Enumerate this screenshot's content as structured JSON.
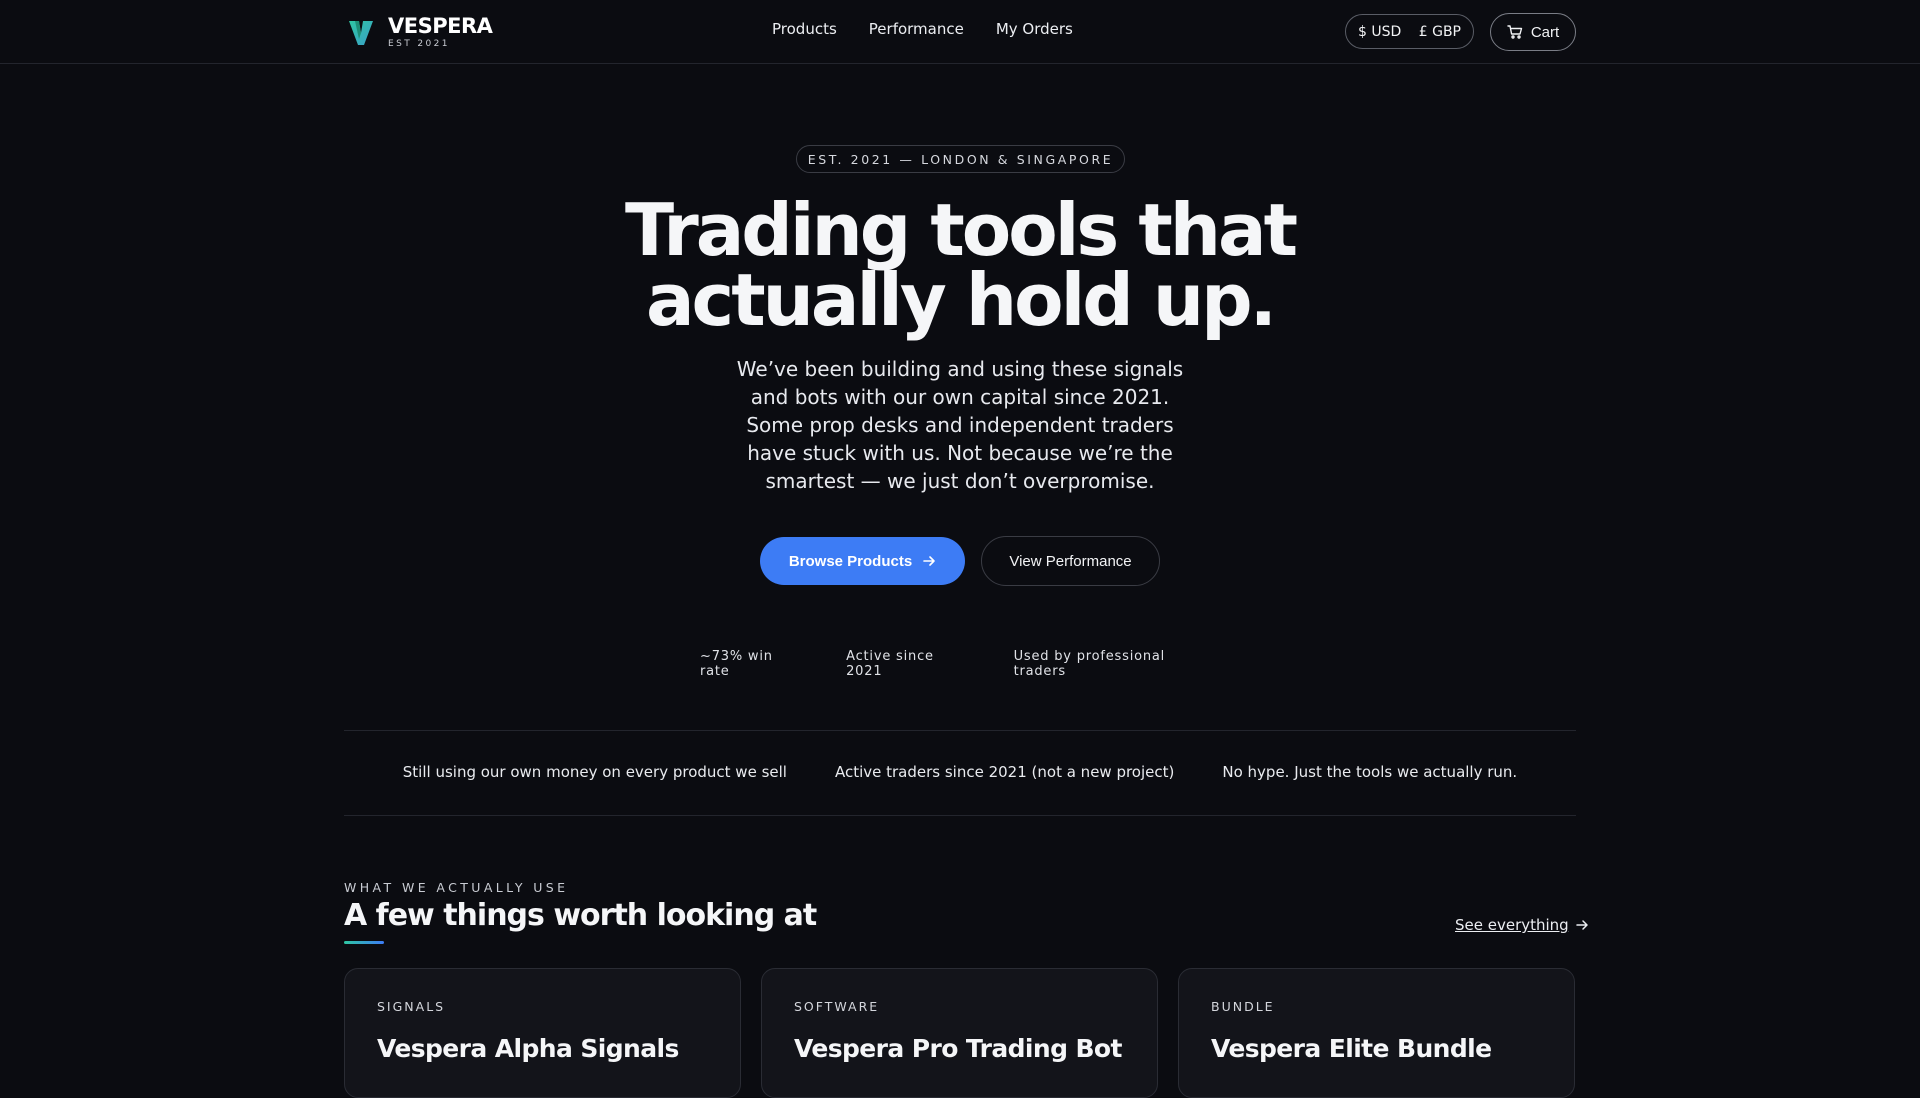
{
  "brand": {
    "name": "VESPERA",
    "tagline": "EST 2021"
  },
  "nav": {
    "items": [
      "Products",
      "Performance",
      "My Orders"
    ]
  },
  "currency": {
    "usd": "$ USD",
    "gbp": "£ GBP"
  },
  "cart": {
    "label": "Cart"
  },
  "hero": {
    "badge": "EST. 2021 — LONDON & SINGAPORE",
    "title_line1": "Trading tools that",
    "title_line2": "actually hold up.",
    "subtitle": "We’ve been building and using these signals and bots with our own capital since 2021. Some prop desks and independent traders have stuck with us. Not because we’re the smartest — we just don’t overpromise.",
    "primary_cta": "Browse Products",
    "secondary_cta": "View Performance"
  },
  "stats": [
    "~73% win rate",
    "Active since 2021",
    "Used by professional traders"
  ],
  "trust": [
    "Still using our own money on every product we sell",
    "Active traders since 2021 (not a new project)",
    "No hype. Just the tools we actually run."
  ],
  "section": {
    "kicker": "WHAT WE ACTUALLY USE",
    "title": "A few things worth looking at",
    "see_all": "See everything"
  },
  "cards": [
    {
      "category": "SIGNALS",
      "title": "Vespera Alpha Signals"
    },
    {
      "category": "SOFTWARE",
      "title": "Vespera Pro Trading Bot"
    },
    {
      "category": "BUNDLE",
      "title": "Vespera Elite Bundle"
    }
  ],
  "colors": {
    "accent": "#3d7cf5",
    "teal": "#2fc6a2",
    "background": "#0b0c11"
  }
}
